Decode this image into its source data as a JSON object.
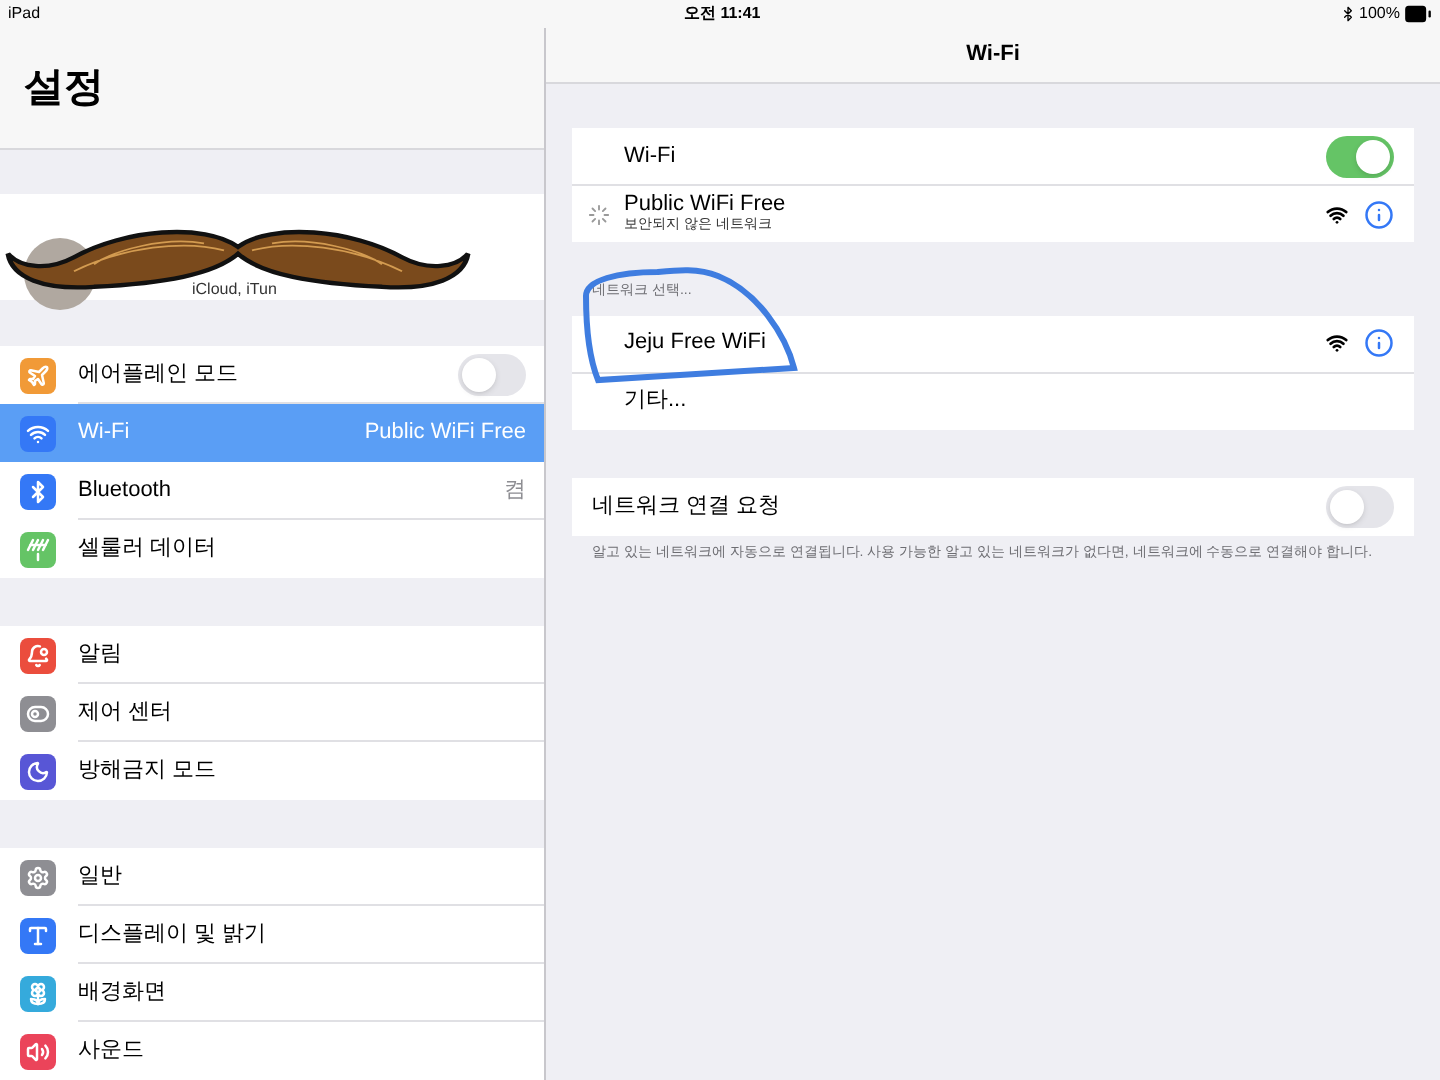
{
  "status_bar": {
    "device": "iPad",
    "time": "오전 11:41",
    "battery": "100%"
  },
  "sidebar": {
    "title": "설정",
    "profile": {
      "subtitle": "iCloud, iTun"
    },
    "groups": [
      [
        {
          "label": "에어플레인 모드",
          "kind": "toggle",
          "on": false,
          "selected": false
        },
        {
          "label": "Wi-Fi",
          "kind": "value",
          "value": "Public WiFi Free",
          "selected": true
        },
        {
          "label": "Bluetooth",
          "kind": "value",
          "value": "켬",
          "selected": false
        },
        {
          "label": "셀룰러 데이터",
          "kind": "plain",
          "selected": false
        }
      ],
      [
        {
          "label": "알림",
          "kind": "plain",
          "selected": false
        },
        {
          "label": "제어 센터",
          "kind": "plain",
          "selected": false
        },
        {
          "label": "방해금지 모드",
          "kind": "plain",
          "selected": false
        }
      ],
      [
        {
          "label": "일반",
          "kind": "plain",
          "selected": false
        },
        {
          "label": "디스플레이 및 밝기",
          "kind": "plain",
          "selected": false
        },
        {
          "label": "배경화면",
          "kind": "plain",
          "selected": false
        },
        {
          "label": "사운드",
          "kind": "plain",
          "selected": false
        }
      ]
    ]
  },
  "detail": {
    "title": "Wi-Fi",
    "wifi": {
      "label": "Wi-Fi",
      "on": true
    },
    "current": {
      "name": "Public WiFi Free",
      "status": "보안되지 않은 네트워크",
      "connecting": true
    },
    "section_header": "네트워크 선택...",
    "networks": [
      {
        "name": "Jeju Free WiFi"
      }
    ],
    "other": "기타...",
    "ask_to_join": {
      "label": "네트워크 연결 요청",
      "on": false
    },
    "footer": "알고 있는 네트워크에 자동으로 연결됩니다. 사용 가능한 알고 있는 네트워크가 없다면, 네트워크에 수동으로 연결해야 합니다."
  }
}
